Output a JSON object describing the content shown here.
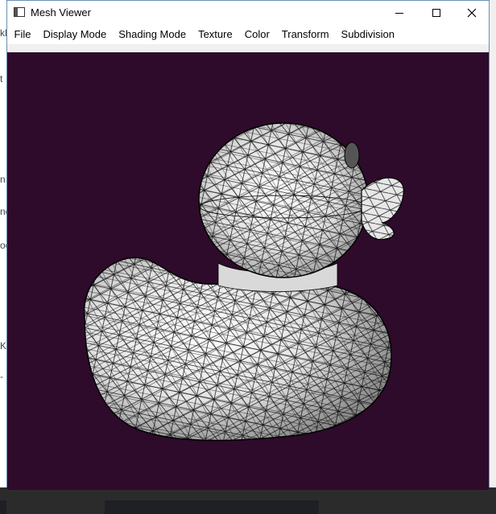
{
  "window": {
    "title": "Mesh Viewer"
  },
  "menu": {
    "items": [
      "File",
      "Display Mode",
      "Shading Mode",
      "Texture",
      "Color",
      "Transform",
      "Subdivision"
    ]
  },
  "viewport": {
    "background_color": "#2e0a2b",
    "model_fill_color": "#e6e6e6",
    "wire_color": "#000000"
  },
  "background_app": {
    "left_edge_glyphs": [
      "kl",
      "t",
      "n",
      "ne",
      "oc",
      "Ka",
      "-"
    ]
  },
  "icons": {
    "app": "app-window-icon",
    "minimize": "minimize-icon",
    "maximize": "maximize-icon",
    "close": "close-icon"
  }
}
